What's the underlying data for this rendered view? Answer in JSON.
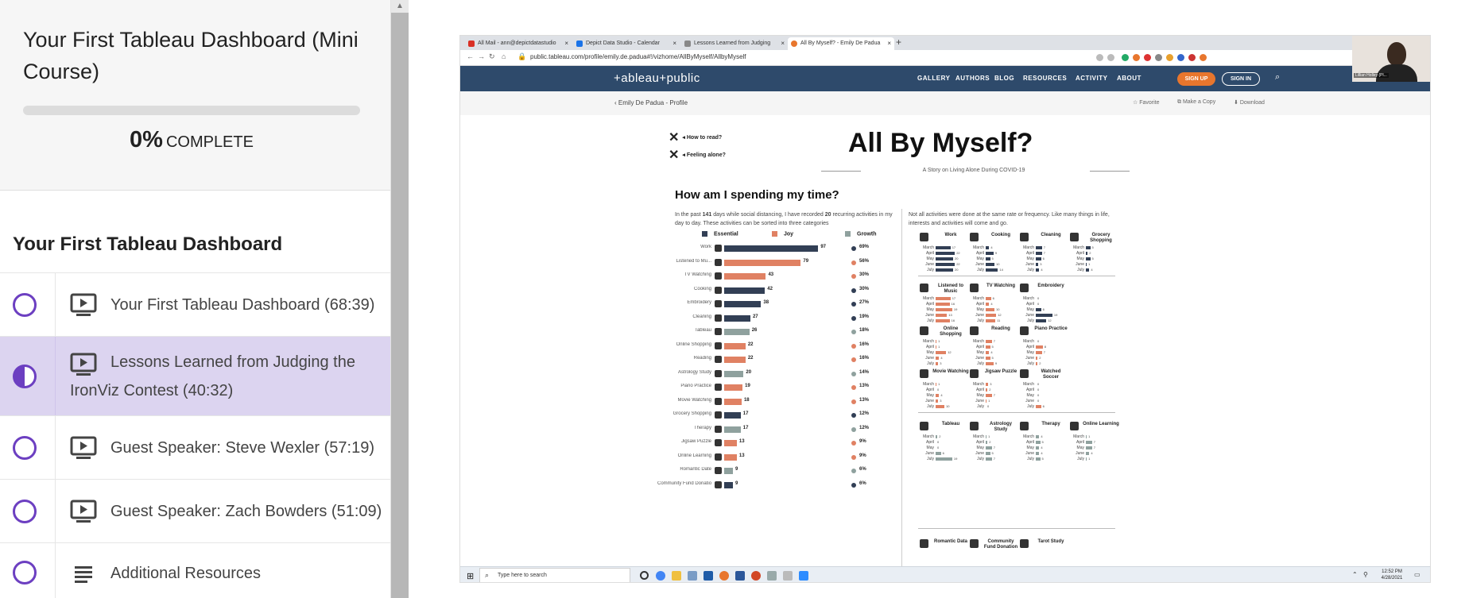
{
  "course": {
    "title": "Your First Tableau Dashboard (Mini Course)",
    "progress_value": "0%",
    "progress_label": "Complete",
    "progress_fraction": 0,
    "accent_color": "#6c3fc1"
  },
  "section": {
    "title": "Your First Tableau Dashboard"
  },
  "lessons": [
    {
      "title": "Your First Tableau Dashboard (68:39)",
      "type": "video",
      "status": "not-started"
    },
    {
      "title": "Lessons Learned from Judging the IronViz Contest (40:32)",
      "type": "video",
      "status": "in-progress"
    },
    {
      "title": "Guest Speaker: Steve Wexler (57:19)",
      "type": "video",
      "status": "not-started"
    },
    {
      "title": "Guest Speaker: Zach Bowders (51:09)",
      "type": "video",
      "status": "not-started"
    },
    {
      "title": "Additional Resources",
      "type": "text",
      "status": "not-started"
    }
  ],
  "browser": {
    "tabs": [
      {
        "label": "All Mail - ann@depictdatastudio",
        "icon": "gmail-icon"
      },
      {
        "label": "Depict Data Studio - Calendar",
        "icon": "calendar-icon"
      },
      {
        "label": "Lessons Learned from Judging",
        "icon": "lesson-icon"
      },
      {
        "label": "All By Myself? - Emily De Padua",
        "icon": "tableau-icon"
      }
    ],
    "url": "public.tableau.com/profile/emily.de.padua#!/vizhome/AllByMyself/AllbyMyself",
    "webcam_name": "Lillian Holley (Pl..."
  },
  "tableau": {
    "logo": "+ableau+public",
    "nav": [
      "GALLERY",
      "AUTHORS",
      "BLOG",
      "RESOURCES",
      "ACTIVITY",
      "ABOUT"
    ],
    "signup": "SIGN UP",
    "signin": "SIGN IN",
    "back_link": "Emily De Padua - Profile",
    "actions": [
      "Favorite",
      "Make a Copy",
      "Download"
    ]
  },
  "viz": {
    "title": "All By Myself?",
    "subtitle": "A Story on Living Alone During COVID-19",
    "help1": "How to read?",
    "help2": "Feeling alone?",
    "question": "How am I spending my time?",
    "intro_left_a": "In the past ",
    "intro_days": "141",
    "intro_left_b": " days while social distancing, I have recorded ",
    "intro_count": "20",
    "intro_left_c": " recurring activities in my day to day. These activities can be sorted into three categories",
    "intro_right": "Not all activities were done at the same rate or frequency. Like many things in life, interests and activities will come and go.",
    "legend": [
      "Essential",
      "Joy",
      "Growth"
    ],
    "colors": {
      "essential": "#323f55",
      "joy": "#e08163",
      "growth": "#8fa19e"
    }
  },
  "chart_data": {
    "type": "bar",
    "title": "",
    "categories": [
      "Work",
      "Listened to Mu...",
      "TV Watching",
      "Cooking",
      "Embroidery",
      "Cleaning",
      "Tableau",
      "Online Shopping",
      "Reading",
      "Astrology Study",
      "Piano Practice",
      "Movie Watching",
      "Grocery Shopping",
      "Therapy",
      "Jigsaw Puzzle",
      "Online Learning",
      "Romantic Date",
      "Community Fund Donation"
    ],
    "values": [
      97,
      79,
      43,
      42,
      38,
      27,
      26,
      22,
      22,
      20,
      19,
      18,
      17,
      17,
      13,
      13,
      9,
      9
    ],
    "category_type": [
      "essential",
      "joy",
      "joy",
      "essential",
      "essential",
      "essential",
      "growth",
      "joy",
      "joy",
      "growth",
      "joy",
      "joy",
      "essential",
      "growth",
      "joy",
      "joy",
      "growth",
      "essential"
    ],
    "percent_labels": [
      "69%",
      "56%",
      "30%",
      "30%",
      "27%",
      "19%",
      "18%",
      "16%",
      "16%",
      "14%",
      "13%",
      "13%",
      "12%",
      "12%",
      "9%",
      "9%",
      "6%",
      "6%"
    ],
    "xlim": [
      0,
      100
    ]
  },
  "small_multiples": {
    "months": [
      "March",
      "April",
      "May",
      "June",
      "July"
    ],
    "panels": [
      {
        "name": "Work",
        "type": "essential",
        "values": [
          17,
          22,
          20,
          22,
          20
        ]
      },
      {
        "name": "Cooking",
        "type": "essential",
        "values": [
          4,
          9,
          5,
          10,
          14
        ]
      },
      {
        "name": "Cleaning",
        "type": "essential",
        "values": [
          7,
          7,
          6,
          3,
          4
        ]
      },
      {
        "name": "Grocery Shopping",
        "type": "essential",
        "values": [
          5,
          2,
          5,
          1,
          4
        ]
      },
      {
        "name": "Listened to Music",
        "type": "joy",
        "values": [
          17,
          16,
          19,
          13,
          16
        ]
      },
      {
        "name": "TV Watching",
        "type": "joy",
        "values": [
          6,
          4,
          10,
          12,
          11
        ]
      },
      {
        "name": "Embroidery",
        "type": "essential",
        "values": [
          0,
          0,
          6,
          19,
          12
        ]
      },
      {
        "name": "Online Shopping",
        "type": "joy",
        "values": [
          1,
          1,
          12,
          4,
          3
        ]
      },
      {
        "name": "Reading",
        "type": "joy",
        "values": [
          7,
          5,
          4,
          5,
          9
        ]
      },
      {
        "name": "Piano Practice",
        "type": "joy",
        "values": [
          0,
          8,
          7,
          2,
          2
        ]
      },
      {
        "name": "Movie Watching",
        "type": "joy",
        "values": [
          1,
          0,
          4,
          3,
          10
        ]
      },
      {
        "name": "Jigsaw Puzzle",
        "type": "joy",
        "values": [
          3,
          2,
          7,
          1,
          0
        ]
      },
      {
        "name": "Watched Soccer",
        "type": "joy",
        "values": [
          0,
          0,
          0,
          0,
          6
        ]
      },
      {
        "name": "Tableau",
        "type": "growth",
        "values": [
          2,
          0,
          0,
          6,
          19
        ]
      },
      {
        "name": "Astrology Study",
        "type": "growth",
        "values": [
          1,
          2,
          7,
          5,
          7
        ]
      },
      {
        "name": "Therapy",
        "type": "growth",
        "values": [
          4,
          5,
          4,
          4,
          5
        ]
      },
      {
        "name": "Online Learning",
        "type": "growth",
        "values": [
          1,
          7,
          7,
          4,
          1
        ]
      }
    ],
    "bottom_row": [
      "Romantic Data",
      "Community Fund Donation",
      "Tarot Study"
    ]
  },
  "taskbar": {
    "search_placeholder": "Type here to search",
    "time": "12:52 PM",
    "date": "4/28/2021"
  }
}
